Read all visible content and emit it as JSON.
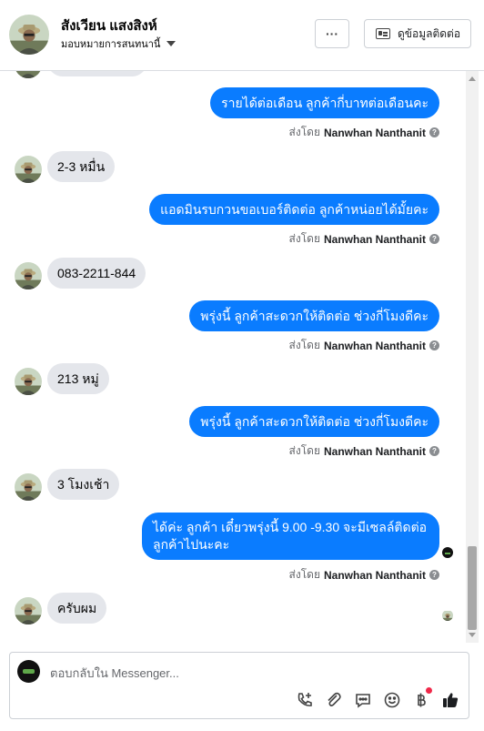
{
  "header": {
    "name": "สังเวียน แสงสิงห์",
    "assigned": "มอบหมายการสนทนานี้",
    "more_label": "···",
    "view_info_label": "ดูข้อมูลติดต่อ"
  },
  "thread": {
    "sent_by_prefix": "ส่งโดย",
    "agent_name": "Nanwhan Nanthanit",
    "messages": [
      {
        "dir": "out",
        "text": "รายได้ต่อเดือน ลูกค้ากี่บาทต่อเดือนคะ"
      },
      {
        "dir": "in",
        "text": "2-3 หมื่น"
      },
      {
        "dir": "out",
        "text": "แอดมินรบกวนขอเบอร์ติดต่อ ลูกค้าหน่อยได้มั้ยคะ"
      },
      {
        "dir": "in",
        "text": "083-2211-844"
      },
      {
        "dir": "out",
        "text": "พรุ่งนี้ ลูกค้าสะดวกให้ติดต่อ ช่วงกี่โมงดีคะ"
      },
      {
        "dir": "in",
        "text": "213 หมู่"
      },
      {
        "dir": "out",
        "text": "พรุ่งนี้ ลูกค้าสะดวกให้ติดต่อ ช่วงกี่โมงดีคะ"
      },
      {
        "dir": "in",
        "text": "3 โมงเช้า"
      },
      {
        "dir": "out",
        "text": "ได้ค่ะ ลูกค้า เดี๋ยวพรุ่งนี้ 9.00 -9.30 จะมีเซลล์ติดต่อลูกค้าไปนะคะ"
      },
      {
        "dir": "in",
        "text": "ครับผม"
      }
    ]
  },
  "composer": {
    "placeholder": "ตอบกลับใน Messenger..."
  },
  "icons": {
    "tools": [
      "call-add-icon",
      "attachment-icon",
      "chat-bubble-icon",
      "emoji-icon",
      "baht-icon",
      "thumbs-up-icon"
    ]
  },
  "colors": {
    "outgoing_bubble": "#0a7cff",
    "incoming_bubble": "#e4e6eb",
    "like_icon": "#1c1e21",
    "notification_dot": "#f02849"
  }
}
